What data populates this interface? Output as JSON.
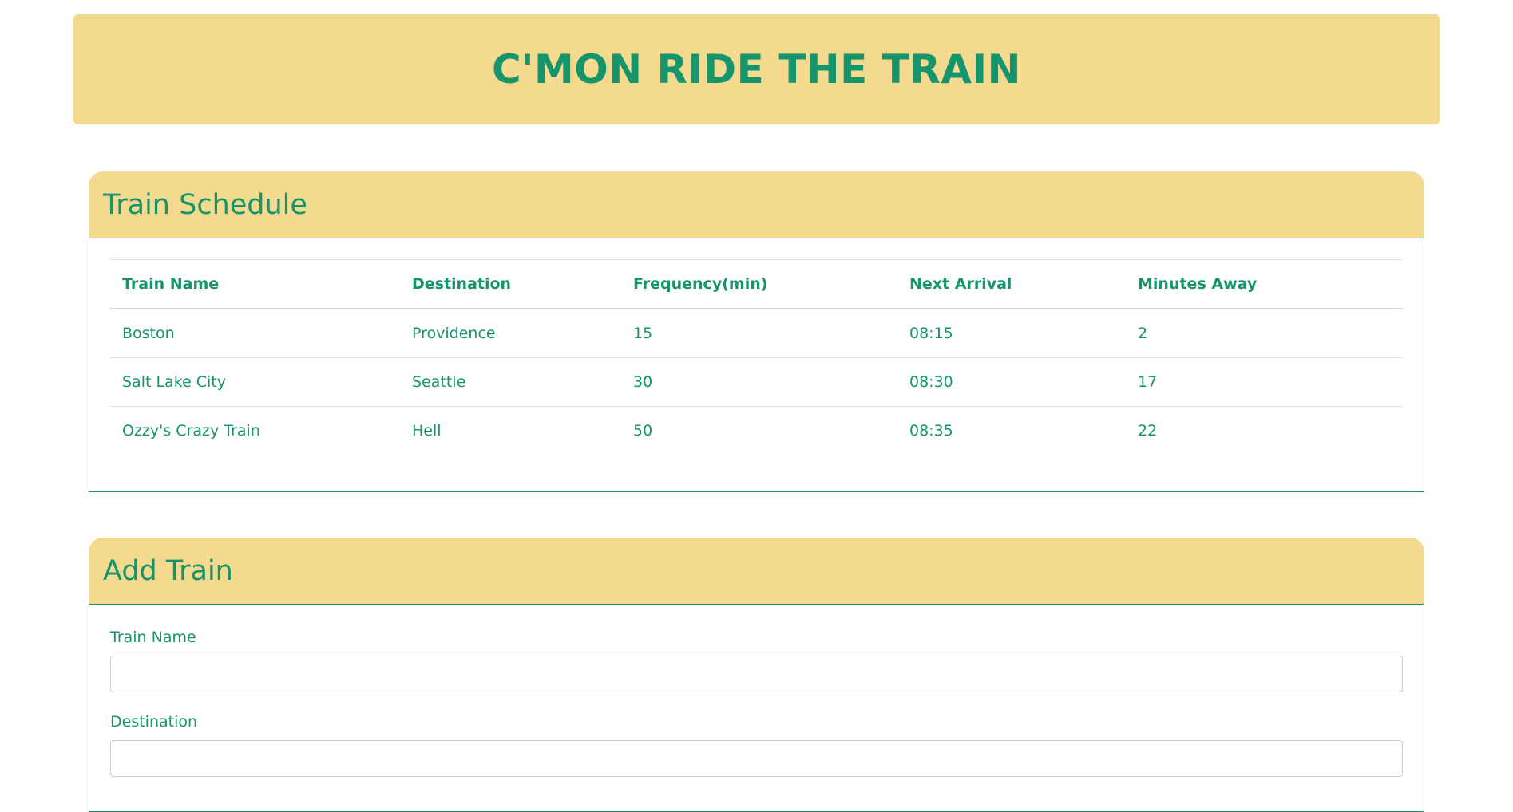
{
  "header": {
    "title": "C'MON RIDE THE TRAIN"
  },
  "schedule": {
    "title": "Train Schedule",
    "columns": [
      "Train Name",
      "Destination",
      "Frequency(min)",
      "Next Arrival",
      "Minutes Away"
    ],
    "rows": [
      [
        "Boston",
        "Providence",
        "15",
        "08:15",
        "2"
      ],
      [
        "Salt Lake City",
        "Seattle",
        "30",
        "08:30",
        "17"
      ],
      [
        "Ozzy's Crazy Train",
        "Hell",
        "50",
        "08:35",
        "22"
      ]
    ]
  },
  "add_train": {
    "title": "Add Train",
    "fields": [
      {
        "label": "Train Name",
        "value": ""
      },
      {
        "label": "Destination",
        "value": ""
      }
    ]
  },
  "colors": {
    "accent": "#16946b",
    "header_bg": "#f3da8f"
  }
}
